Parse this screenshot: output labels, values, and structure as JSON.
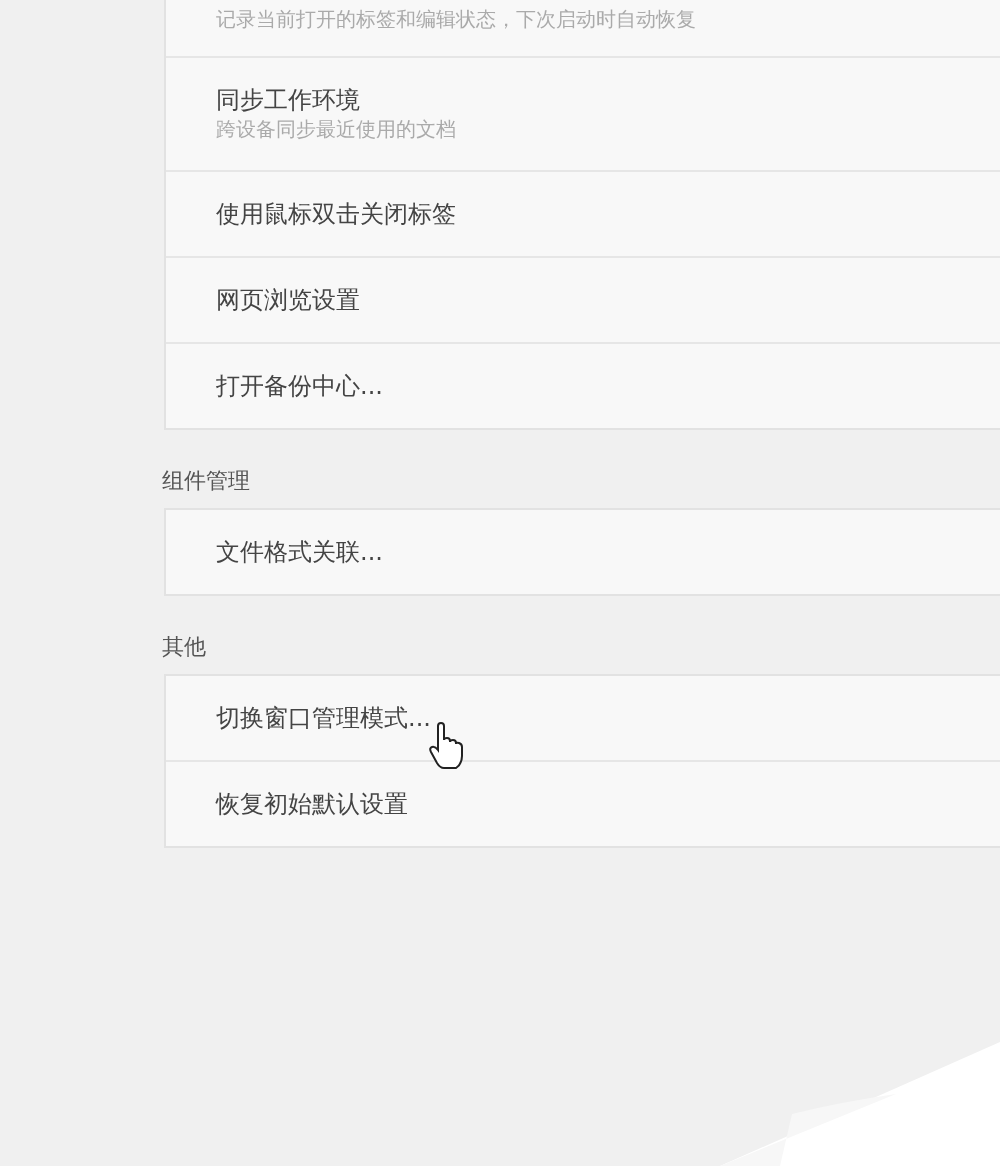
{
  "sections": [
    {
      "items": [
        {
          "subtitle": "记录当前打开的标签和编辑状态，下次启动时自动恢复"
        },
        {
          "title": "同步工作环境",
          "subtitle": "跨设备同步最近使用的文档"
        },
        {
          "title": "使用鼠标双击关闭标签"
        },
        {
          "title": "网页浏览设置"
        },
        {
          "title": "打开备份中心..."
        }
      ]
    },
    {
      "heading": "组件管理",
      "items": [
        {
          "title": "文件格式关联..."
        }
      ]
    },
    {
      "heading": "其他",
      "items": [
        {
          "title": "切换窗口管理模式..."
        },
        {
          "title": "恢复初始默认设置"
        }
      ]
    }
  ]
}
